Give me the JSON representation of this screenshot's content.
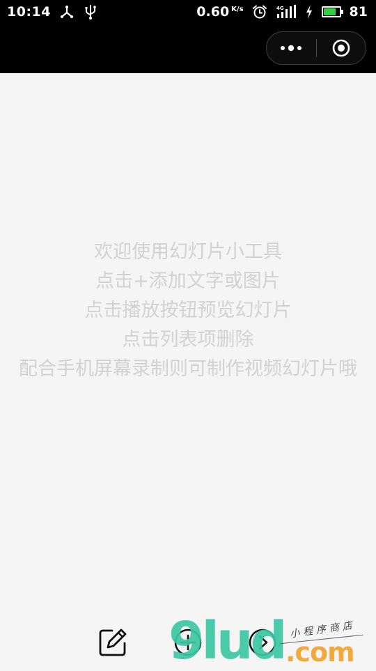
{
  "status_bar": {
    "time": "10:14",
    "net_speed": "0.60",
    "net_speed_unit": "K/s",
    "battery_level": "81",
    "battery_fraction": 0.81,
    "battery_color": "#2fd23a"
  },
  "nav": {
    "more_icon": "more-dots-icon",
    "close_icon": "target-close-icon"
  },
  "tips": {
    "lines": [
      "欢迎使用幻灯片小工具",
      "点击+添加文字或图片",
      "点击播放按钮预览幻灯片",
      "点击列表项删除",
      "配合手机屏幕录制则可制作视频幻灯片哦"
    ],
    "color": "#d2d2d2"
  },
  "toolbar": {
    "edit_icon": "edit-icon",
    "add_icon": "add-circle-icon",
    "play_icon": "play-circle-icon"
  },
  "watermark": {
    "brand": "9lud",
    "domain": ".com",
    "tagline": "小程序商店"
  }
}
